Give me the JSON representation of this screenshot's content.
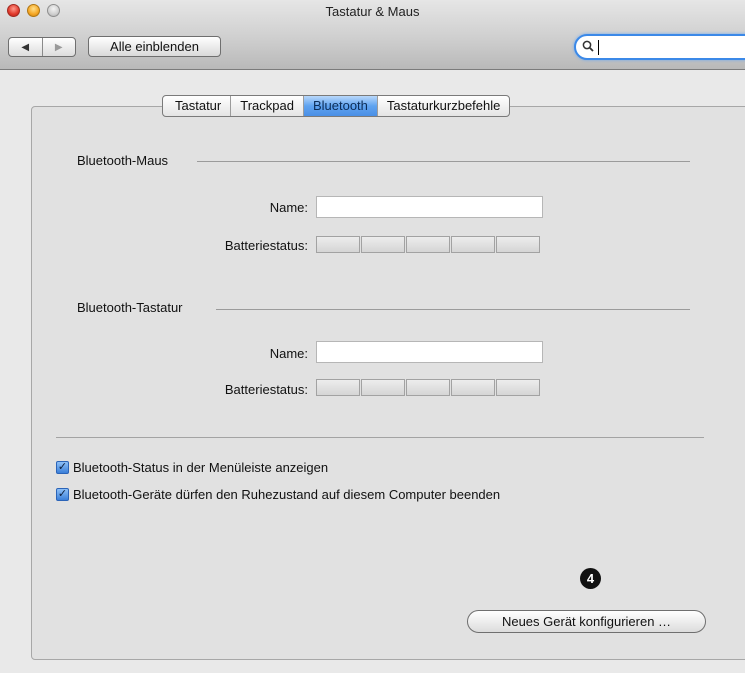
{
  "window": {
    "title": "Tastatur & Maus"
  },
  "toolbar": {
    "back_glyph": "◀",
    "forward_glyph": "▶",
    "show_all_label": "Alle einblenden",
    "search_placeholder": "",
    "search_icon_glyph": "🔍"
  },
  "tabs": [
    {
      "label": "Tastatur",
      "active": false
    },
    {
      "label": "Trackpad",
      "active": false
    },
    {
      "label": "Bluetooth",
      "active": true
    },
    {
      "label": "Tastaturkurzbefehle",
      "active": false
    }
  ],
  "mouse": {
    "section_title": "Bluetooth-Maus",
    "name_label": "Name:",
    "name_value": "",
    "battery_label": "Batteriestatus:",
    "battery_level": 0
  },
  "keyboard": {
    "section_title": "Bluetooth-Tastatur",
    "name_label": "Name:",
    "name_value": "",
    "battery_label": "Batteriestatus:",
    "battery_level": 0
  },
  "options": {
    "show_in_menubar": {
      "label": "Bluetooth-Status in der Menüleiste anzeigen",
      "checked": true
    },
    "allow_wake": {
      "label": "Bluetooth-Geräte dürfen den Ruhezustand auf diesem Computer beenden",
      "checked": true
    }
  },
  "annotation_marker": "4",
  "new_device_button_label": "Neues Gerät konfigurieren …",
  "colors": {
    "accent": "#4a8fe6",
    "panel_bg": "#e1e1e1"
  }
}
